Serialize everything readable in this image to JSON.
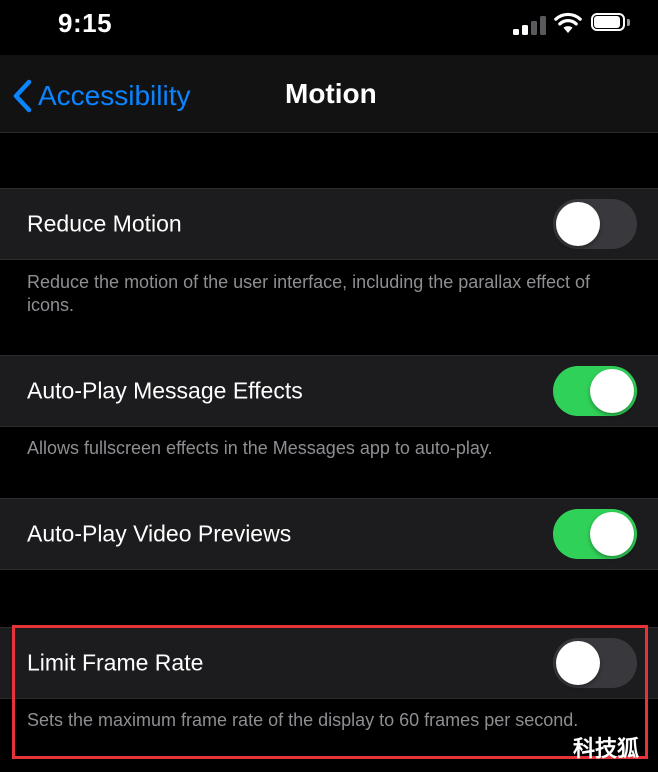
{
  "status_bar": {
    "time": "9:15"
  },
  "nav": {
    "back_label": "Accessibility",
    "title": "Motion"
  },
  "settings": [
    {
      "label": "Reduce Motion",
      "enabled": false,
      "footer": "Reduce the motion of the user interface, including the parallax effect of icons."
    },
    {
      "label": "Auto-Play Message Effects",
      "enabled": true,
      "footer": "Allows fullscreen effects in the Messages app to auto-play."
    },
    {
      "label": "Auto-Play Video Previews",
      "enabled": true,
      "footer": ""
    },
    {
      "label": "Limit Frame Rate",
      "enabled": false,
      "footer": "Sets the maximum frame rate of the display to 60 frames per second."
    }
  ],
  "watermark": "科技狐",
  "colors": {
    "accent": "#0a84ff",
    "toggle_on": "#30d158",
    "toggle_off": "#39393d",
    "highlight": "#e5333a"
  },
  "icons": {
    "back": "chevron-left-icon",
    "signal": "cellular-signal-icon",
    "wifi": "wifi-icon",
    "battery": "battery-icon"
  }
}
